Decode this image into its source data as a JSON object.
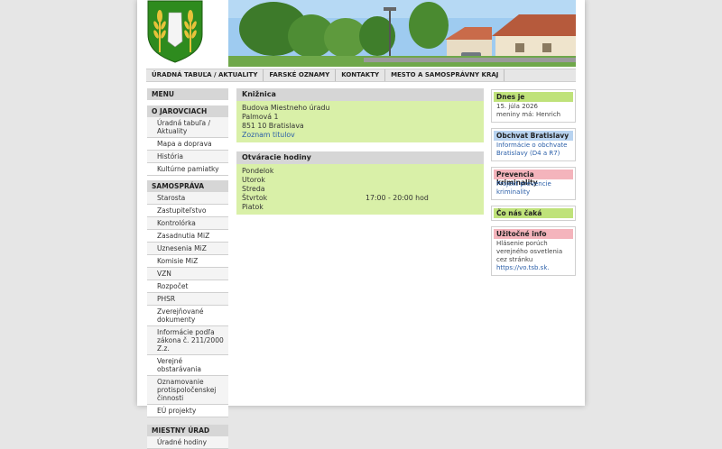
{
  "colors": {
    "accent_green": "#d9f0a8",
    "header_green": "#bfe27a",
    "header_blue": "#b8d3f0",
    "header_red": "#f4b4bc",
    "link_blue": "#2b5fa8"
  },
  "topnav": [
    "ÚRADNÁ TABUĽA / AKTUALITY",
    "FARSKÉ OZNAMY",
    "KONTAKTY",
    "MESTO A SAMOSPRÁVNY KRAJ"
  ],
  "sidebar": {
    "menu_title": "MENU",
    "sections": [
      {
        "title": "O JAROVCIACH",
        "items": [
          "Úradná tabuľa / Aktuality",
          "Mapa a doprava",
          "História",
          "Kultúrne pamiatky"
        ]
      },
      {
        "title": "SAMOSPRÁVA",
        "items": [
          "Starosta",
          "Zastupiteľstvo",
          "Kontrolórka",
          "Zasadnutia MiZ",
          "Uznesenia MiZ",
          "Komisie MiZ",
          "VZN",
          "Rozpočet",
          "PHSR",
          "Zverejňované dokumenty",
          "Informácie podľa zákona č. 211/2000 Z.z.",
          "Verejné obstarávania",
          "Oznamovanie protispoločenskej činnosti",
          "EÚ projekty"
        ]
      },
      {
        "title": "MIESTNY ÚRAD",
        "items": [
          "Úradné hodiny"
        ]
      }
    ]
  },
  "main": {
    "library": {
      "title": "Knižnica",
      "lines": [
        "Budova Miestneho úradu",
        "Palmová 1",
        "851 10 Bratislava"
      ],
      "link": "Zoznam titulov"
    },
    "hours": {
      "title": "Otváracie hodiny",
      "rows": [
        {
          "day": "Pondelok",
          "time": ""
        },
        {
          "day": "Utorok",
          "time": ""
        },
        {
          "day": "Streda",
          "time": ""
        },
        {
          "day": "Štvrtok",
          "time": "17:00 - 20:00 hod"
        },
        {
          "day": "Piatok",
          "time": ""
        }
      ]
    }
  },
  "right": {
    "today": {
      "title": "Dnes je",
      "date": "15. júla 2026",
      "nameday": "meniny má: Henrich"
    },
    "bypass": {
      "title": "Obchvat Bratislavy",
      "link": "Informácie o obchvate Bratislavy (D4 a R7)"
    },
    "crime": {
      "title": "Prevencia kriminality",
      "link": "Projekt prevencie kriminality"
    },
    "events": {
      "title": "Čo nás čaká"
    },
    "useful": {
      "title": "Užitočné info",
      "text": "Hlásenie porúch verejného osvetlenia cez stránku",
      "link": "https://vo.tsb.sk."
    }
  }
}
